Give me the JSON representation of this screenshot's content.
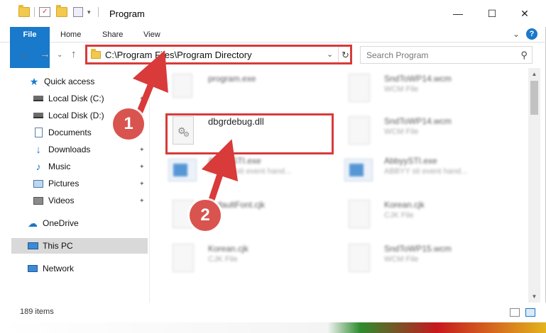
{
  "window": {
    "title": "Program",
    "minimize": "—",
    "maximize": "☐",
    "close": "✕"
  },
  "ribbon": {
    "tabs": [
      "File",
      "Home",
      "Share",
      "View"
    ],
    "expand": "⌄",
    "help": "?"
  },
  "nav": {
    "back": "←",
    "forward": "→",
    "recent": "⌄",
    "up": "↑",
    "address": "C:\\Program Files\\Program Directory",
    "address_dropdown": "⌄",
    "refresh": "↻",
    "search_placeholder": "Search Program"
  },
  "sidebar": {
    "items": [
      {
        "label": "Quick access",
        "icon": "star-icon",
        "pinned": false
      },
      {
        "label": "Local Disk (C:)",
        "icon": "drive-icon",
        "pinned": true
      },
      {
        "label": "Local Disk (D:)",
        "icon": "drive-icon",
        "pinned": true
      },
      {
        "label": "Documents",
        "icon": "documents-icon",
        "pinned": true
      },
      {
        "label": "Downloads",
        "icon": "download-icon",
        "pinned": true
      },
      {
        "label": "Music",
        "icon": "music-icon",
        "pinned": true
      },
      {
        "label": "Pictures",
        "icon": "pictures-icon",
        "pinned": true
      },
      {
        "label": "Videos",
        "icon": "videos-icon",
        "pinned": true
      },
      {
        "label": "OneDrive",
        "icon": "cloud-icon",
        "pinned": false
      },
      {
        "label": "This PC",
        "icon": "computer-icon",
        "pinned": false,
        "selected": true
      },
      {
        "label": "Network",
        "icon": "network-icon",
        "pinned": false
      }
    ],
    "pin_glyph": "📌"
  },
  "files": {
    "left": [
      {
        "name": "program.exe",
        "sub": "",
        "blur": true,
        "kind": "exe"
      },
      {
        "name": "dbgrdebug.dll",
        "sub": "",
        "blur": false,
        "kind": "dll"
      },
      {
        "name": "AbbyySTI.exe",
        "sub": "ABBYY sti event hand...",
        "blur": true,
        "kind": "exe"
      },
      {
        "name": "DefaultFont.cjk",
        "sub": "",
        "blur": true,
        "kind": "file"
      },
      {
        "name": "Korean.cjk",
        "sub": "CJK File",
        "blur": true,
        "kind": "file"
      }
    ],
    "right": [
      {
        "name": "SndToWP14.wcm",
        "sub": "WCM File",
        "blur": true,
        "kind": "file"
      },
      {
        "name": "SndToWP14.wcm",
        "sub": "WCM File",
        "blur": true,
        "kind": "file"
      },
      {
        "name": "AbbyySTI.exe",
        "sub": "ABBYY sti event hand...",
        "blur": true,
        "kind": "exe"
      },
      {
        "name": "Korean.cjk",
        "sub": "CJK File",
        "blur": true,
        "kind": "file"
      },
      {
        "name": "SndToWP15.wcm",
        "sub": "WCM File",
        "blur": true,
        "kind": "file"
      }
    ]
  },
  "status": {
    "count": "189 items"
  },
  "annotations": {
    "step1": "1",
    "step2": "2",
    "color": "#d93a3a"
  }
}
